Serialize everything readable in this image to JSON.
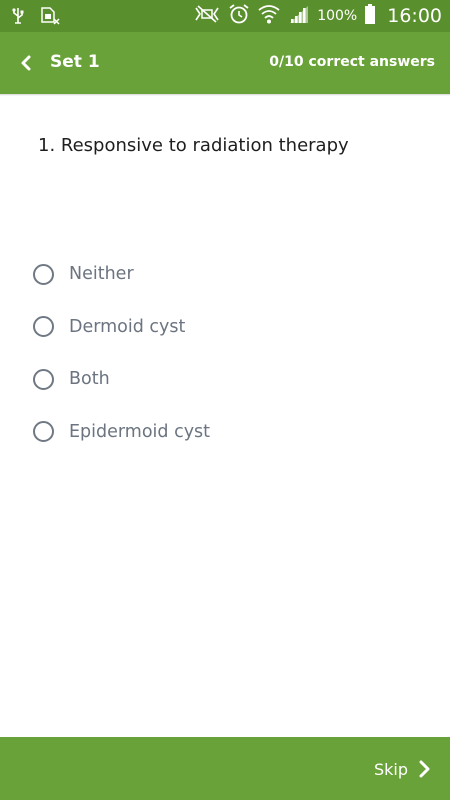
{
  "status_bar": {
    "left_icons": [
      "usb-icon",
      "sim-error-icon"
    ],
    "right_icons": [
      "mute-icon",
      "alarm-icon",
      "wifi-icon",
      "signal-icon",
      "battery-icon"
    ],
    "battery": "100%",
    "time": "16:00"
  },
  "header": {
    "back_icon": "chevron-left-icon",
    "title": "Set 1",
    "score": "0/10 correct answers"
  },
  "question": {
    "text": "1. Responsive to radiation therapy"
  },
  "options": [
    {
      "label": "Neither",
      "selected": false
    },
    {
      "label": "Dermoid cyst",
      "selected": false
    },
    {
      "label": "Both",
      "selected": false
    },
    {
      "label": "Epidermoid cyst",
      "selected": false
    }
  ],
  "footer": {
    "skip_label": "Skip",
    "skip_icon": "chevron-right-icon"
  },
  "colors": {
    "status_bar": "#5a8f2e",
    "app_bar": "#6aa23a",
    "option_text": "#6b7480",
    "radio_border": "#6f7883"
  }
}
